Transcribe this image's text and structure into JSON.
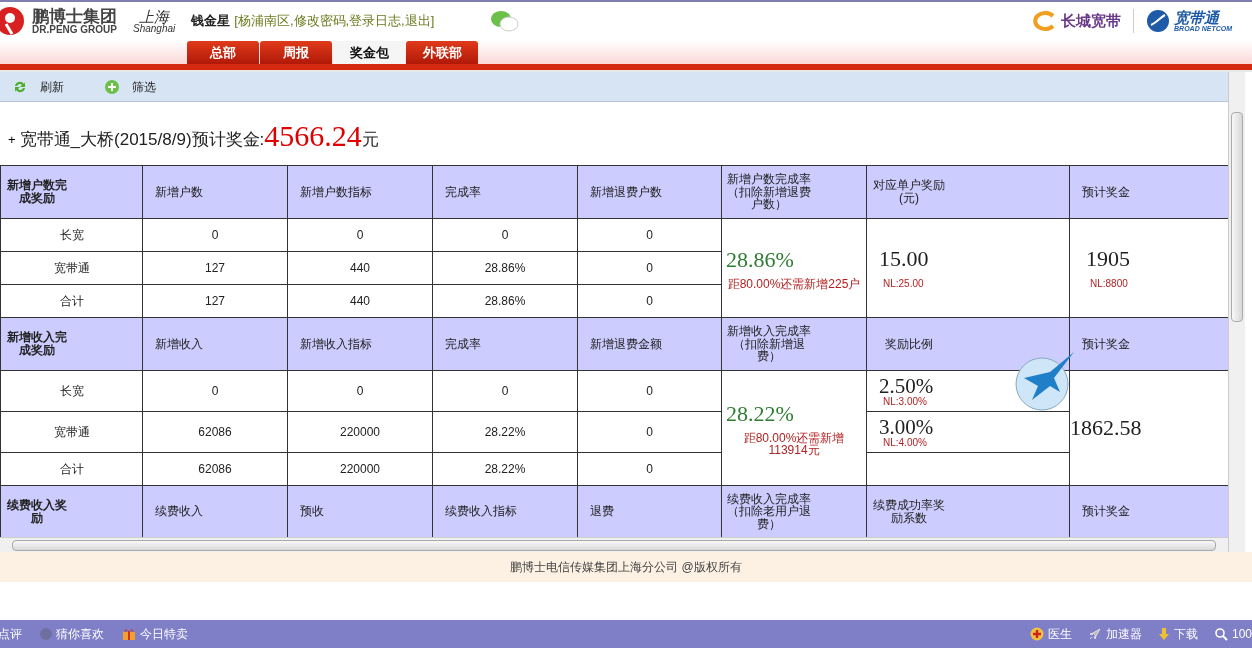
{
  "header": {
    "logo": {
      "name": "鹏博士集团",
      "sub": "DR.PENG GROUP"
    },
    "city": {
      "name": "上海",
      "sub": "Shanghai"
    },
    "user": "钱金星",
    "user_links": "[杨浦南区,修改密码,登录日志,退出]",
    "partners": [
      {
        "name": "长城宽带"
      },
      {
        "name": "宽带通",
        "sub": "BROAD NETCOM"
      }
    ]
  },
  "tabs": [
    {
      "label": "总部",
      "selected": false
    },
    {
      "label": "周报",
      "selected": false
    },
    {
      "label": "奖金包",
      "selected": true
    },
    {
      "label": "外联部",
      "selected": false
    }
  ],
  "toolbar": [
    {
      "label": "刷新",
      "kind": "refresh"
    },
    {
      "label": "筛选",
      "kind": "filter"
    }
  ],
  "title": {
    "prefix": "+",
    "text": "宽带通_大桥(2015/8/9)预计奖金:",
    "amount": "4566.24",
    "unit": "元"
  },
  "sections": [
    {
      "kind": "counts",
      "headers": [
        "新增户数完成奖励",
        "新增户数",
        "新增户数指标",
        "完成率",
        "新增退费户数",
        "新增户数完成率（扣除新增退费户数）",
        "对应单户奖励(元)",
        "预计奖金"
      ],
      "rows": [
        [
          "长宽",
          "0",
          "0",
          "0",
          "0"
        ],
        [
          "宽带通",
          "127",
          "440",
          "28.86%",
          "0"
        ],
        [
          "合计",
          "127",
          "440",
          "28.86%",
          "0"
        ]
      ],
      "rate": "28.86%",
      "rate_note": "距80.00%还需新增225户",
      "reward": "15.00",
      "reward_note": "NL:25.00",
      "bonus": "1905",
      "bonus_note": "NL:8800"
    },
    {
      "kind": "income",
      "headers": [
        "新增收入完成奖励",
        "新增收入",
        "新增收入指标",
        "完成率",
        "新增退费金额",
        "新增收入完成率（扣除新增退费）",
        "奖励比例",
        "预计奖金"
      ],
      "rows": [
        [
          "长宽",
          "0",
          "0",
          "0",
          "0"
        ],
        [
          "宽带通",
          "62086",
          "220000",
          "28.22%",
          "0"
        ],
        [
          "合计",
          "62086",
          "220000",
          "28.22%",
          "0"
        ]
      ],
      "rate": "28.22%",
      "rate_note": "距80.00%还需新增113914元",
      "ratios": [
        {
          "value": "2.50%",
          "note": "NL:3.00%"
        },
        {
          "value": "3.00%",
          "note": "NL:4.00%"
        }
      ],
      "bonus": "1862.58"
    },
    {
      "kind": "renewal",
      "headers": [
        "续费收入奖励",
        "续费收入",
        "预收",
        "续费收入指标",
        "退费",
        "续费收入完成率（扣除老用户退费）",
        "续费成功率奖励系数",
        "预计奖金"
      ]
    }
  ],
  "footer": "鹏博士电信传媒集团上海分公司 @版权所有",
  "taskbar": {
    "left": [
      {
        "label": "点评",
        "kind": "none"
      },
      {
        "label": "猜你喜欢",
        "kind": "dot"
      },
      {
        "label": "今日特卖",
        "kind": "gift"
      }
    ],
    "right": [
      {
        "label": "医生",
        "kind": "doctor"
      },
      {
        "label": "加速器",
        "kind": "rocket"
      },
      {
        "label": "下载",
        "kind": "download"
      },
      {
        "label": "100",
        "kind": "zoom"
      }
    ]
  }
}
